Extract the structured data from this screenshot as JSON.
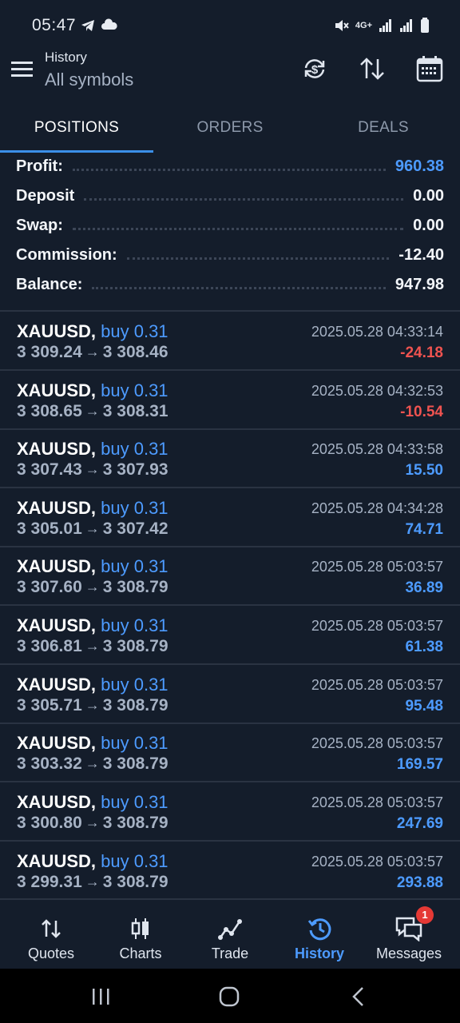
{
  "status_bar": {
    "time": "05:47",
    "left_icons": [
      "telegram-icon",
      "cloud-icon"
    ],
    "right_icons": [
      "mute-icon",
      "4g-icon",
      "signal-icon",
      "signal-icon",
      "battery-icon"
    ],
    "network_label": "4G+"
  },
  "header": {
    "subtitle": "History",
    "title": "All symbols",
    "actions": [
      "currency-refresh-icon",
      "sort-icon",
      "calendar-icon"
    ]
  },
  "tabs": [
    {
      "label": "POSITIONS",
      "active": true
    },
    {
      "label": "ORDERS",
      "active": false
    },
    {
      "label": "DEALS",
      "active": false
    }
  ],
  "summary": {
    "profit": {
      "label": "Profit:",
      "value": "960.38"
    },
    "deposit": {
      "label": "Deposit",
      "value": "0.00"
    },
    "swap": {
      "label": "Swap:",
      "value": "0.00"
    },
    "commission": {
      "label": "Commission:",
      "value": "-12.40"
    },
    "balance": {
      "label": "Balance:",
      "value": "947.98"
    }
  },
  "arrow": "→",
  "positions": [
    {
      "symbol": "XAUUSD,",
      "type": "buy 0.31",
      "open": "3 309.24",
      "close": "3 308.46",
      "time": "2025.05.28 04:33:14",
      "profit": "-24.18"
    },
    {
      "symbol": "XAUUSD,",
      "type": "buy 0.31",
      "open": "3 308.65",
      "close": "3 308.31",
      "time": "2025.05.28 04:32:53",
      "profit": "-10.54"
    },
    {
      "symbol": "XAUUSD,",
      "type": "buy 0.31",
      "open": "3 307.43",
      "close": "3 307.93",
      "time": "2025.05.28 04:33:58",
      "profit": "15.50"
    },
    {
      "symbol": "XAUUSD,",
      "type": "buy 0.31",
      "open": "3 305.01",
      "close": "3 307.42",
      "time": "2025.05.28 04:34:28",
      "profit": "74.71"
    },
    {
      "symbol": "XAUUSD,",
      "type": "buy 0.31",
      "open": "3 307.60",
      "close": "3 308.79",
      "time": "2025.05.28 05:03:57",
      "profit": "36.89"
    },
    {
      "symbol": "XAUUSD,",
      "type": "buy 0.31",
      "open": "3 306.81",
      "close": "3 308.79",
      "time": "2025.05.28 05:03:57",
      "profit": "61.38"
    },
    {
      "symbol": "XAUUSD,",
      "type": "buy 0.31",
      "open": "3 305.71",
      "close": "3 308.79",
      "time": "2025.05.28 05:03:57",
      "profit": "95.48"
    },
    {
      "symbol": "XAUUSD,",
      "type": "buy 0.31",
      "open": "3 303.32",
      "close": "3 308.79",
      "time": "2025.05.28 05:03:57",
      "profit": "169.57"
    },
    {
      "symbol": "XAUUSD,",
      "type": "buy 0.31",
      "open": "3 300.80",
      "close": "3 308.79",
      "time": "2025.05.28 05:03:57",
      "profit": "247.69"
    },
    {
      "symbol": "XAUUSD,",
      "type": "buy 0.31",
      "open": "3 299.31",
      "close": "3 308.79",
      "time": "2025.05.28 05:03:57",
      "profit": "293.88"
    }
  ],
  "bottom_nav": [
    {
      "label": "Quotes",
      "icon": "quotes-icon",
      "active": false
    },
    {
      "label": "Charts",
      "icon": "charts-icon",
      "active": false
    },
    {
      "label": "Trade",
      "icon": "trade-icon",
      "active": false
    },
    {
      "label": "History",
      "icon": "history-icon",
      "active": true
    },
    {
      "label": "Messages",
      "icon": "messages-icon",
      "active": false,
      "badge": "1"
    }
  ],
  "colors": {
    "background": "#141d2b",
    "accent": "#3b8fe8",
    "positive": "#4d9bff",
    "negative": "#ef5350"
  }
}
